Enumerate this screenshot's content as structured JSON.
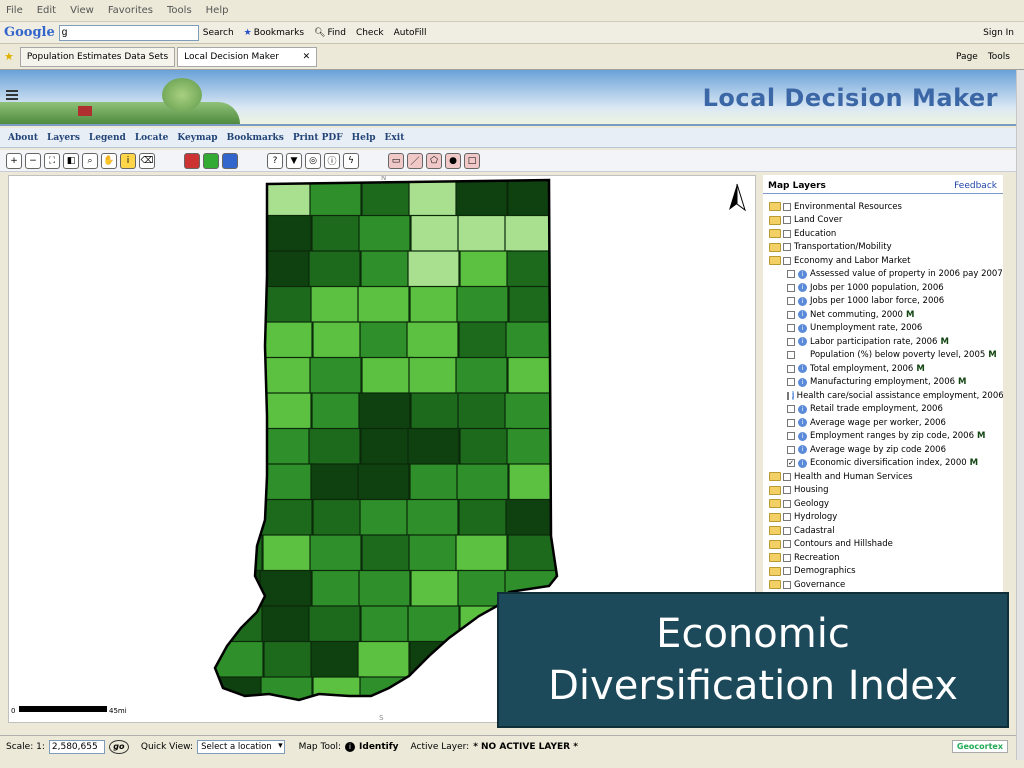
{
  "browser": {
    "menu": [
      "File",
      "Edit",
      "View",
      "Favorites",
      "Tools",
      "Help"
    ],
    "google_logo": "Google",
    "google_input": "g",
    "toolbar_buttons": [
      "Search",
      "Bookmarks",
      "Find",
      "Check",
      "AutoFill"
    ],
    "toolbar_right": [
      "Sign In"
    ],
    "tabs": [
      {
        "label": "Population Estimates Data Sets"
      },
      {
        "label": "Local Decision Maker"
      }
    ],
    "tab_close": "✕",
    "command_bar": [
      "Page",
      "Tools"
    ]
  },
  "app": {
    "title": "Local Decision Maker",
    "nav": [
      "About",
      "Layers",
      "Legend",
      "Locate",
      "Keymap",
      "Bookmarks",
      "Print PDF",
      "Help",
      "Exit"
    ]
  },
  "map": {
    "scale_label_start": "0",
    "scale_label_end": "45mi",
    "north_label": "N",
    "south_label": "S",
    "colors": {
      "light": "#a8e090",
      "mid": "#5cc040",
      "med_dark": "#2f8f2a",
      "dark": "#1d6a1d",
      "very_dark": "#0e4010"
    }
  },
  "layers_panel": {
    "title": "Map Layers",
    "feedback": "Feedback",
    "groups_top": [
      "Environmental Resources",
      "Land Cover",
      "Education",
      "Transportation/Mobility",
      "Economy and Labor Market"
    ],
    "sub_items": [
      {
        "label": "Assessed value of property in 2006 pay 2007",
        "info": true,
        "badge": ""
      },
      {
        "label": "Jobs per 1000 population, 2006",
        "info": true,
        "badge": ""
      },
      {
        "label": "Jobs per 1000 labor force, 2006",
        "info": true,
        "badge": ""
      },
      {
        "label": "Net commuting, 2000",
        "info": true,
        "badge": "M"
      },
      {
        "label": "Unemployment rate, 2006",
        "info": true,
        "badge": ""
      },
      {
        "label": "Labor participation rate, 2006",
        "info": true,
        "badge": "M"
      },
      {
        "label": "Population (%) below poverty level, 2005",
        "info": false,
        "badge": "M"
      },
      {
        "label": "Total employment, 2006",
        "info": true,
        "badge": "M"
      },
      {
        "label": "Manufacturing employment, 2006",
        "info": true,
        "badge": "M"
      },
      {
        "label": "Health care/social assistance employment, 2006",
        "info": true,
        "badge": ""
      },
      {
        "label": "Retail trade employment, 2006",
        "info": true,
        "badge": ""
      },
      {
        "label": "Average wage per worker, 2006",
        "info": true,
        "badge": ""
      },
      {
        "label": "Employment ranges by zip code, 2006",
        "info": true,
        "badge": "M"
      },
      {
        "label": "Average wage by zip code 2006",
        "info": true,
        "badge": ""
      },
      {
        "label": "Economic diversification index, 2000",
        "info": true,
        "badge": "M",
        "checked": true
      }
    ],
    "groups_bottom": [
      "Health and Human Services",
      "Housing",
      "Geology",
      "Hydrology",
      "Cadastral",
      "Contours and Hillshade",
      "Recreation",
      "Demographics",
      "Governance"
    ]
  },
  "overlay": {
    "line1": "Economic",
    "line2": "Diversification Index"
  },
  "status": {
    "scale_label": "Scale: 1:",
    "scale_value": "2,580,655",
    "go": "go",
    "quick_view_label": "Quick View:",
    "quick_view_value": "Select a location",
    "map_tool_label": "Map Tool:",
    "map_tool_value": "Identify",
    "active_layer_label": "Active Layer:",
    "active_layer_value": "* NO ACTIVE LAYER *",
    "powered_by": "Geocortex"
  }
}
